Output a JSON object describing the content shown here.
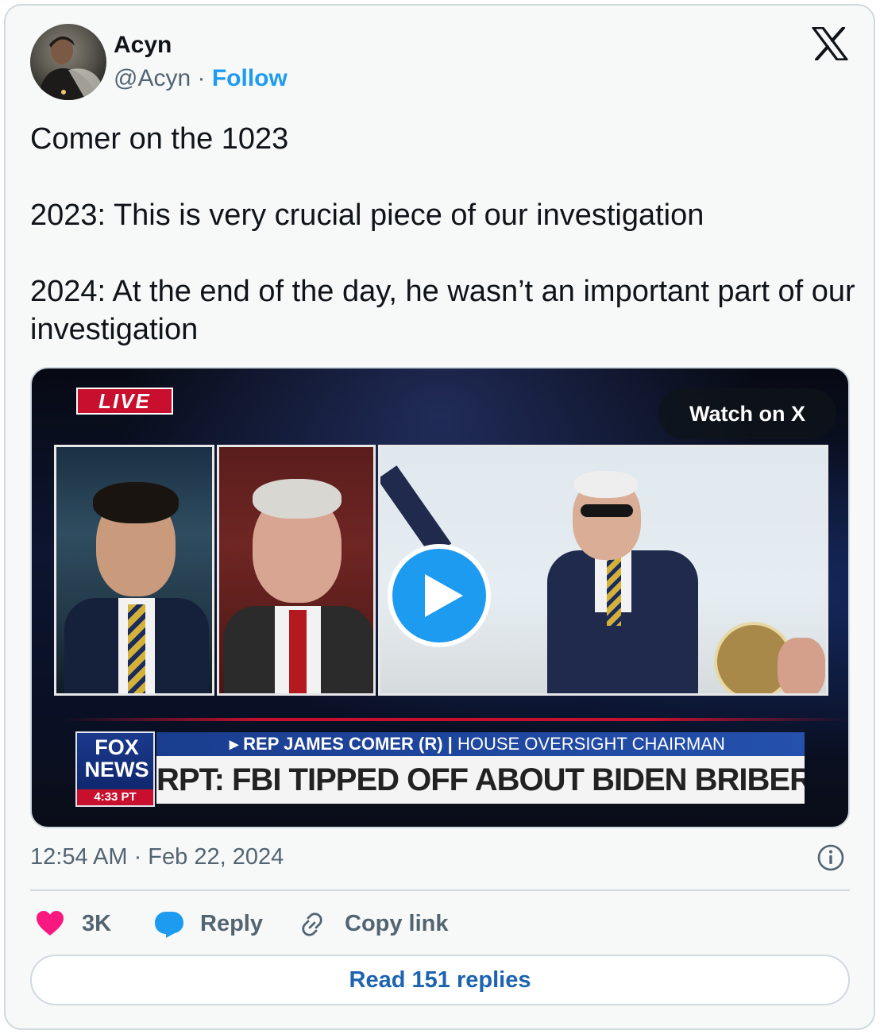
{
  "author": {
    "name": "Acyn",
    "handle": "@Acyn",
    "separator": "·",
    "follow_label": "Follow"
  },
  "platform_icon": "x-logo-icon",
  "tweet": {
    "line1": "Comer on the 1023",
    "line2": "2023: This is very crucial piece of our investigation",
    "line3": "2024: At the end of the day, he wasn’t an important part of our investigation"
  },
  "media": {
    "live_label": "LIVE",
    "watch_label": "Watch on X",
    "network": "FOX NEWS",
    "network_time": "4:33 PT",
    "chyron_name": "REP JAMES COMER (R)",
    "chyron_title": "HOUSE OVERSIGHT CHAIRMAN",
    "chyron_headline": "RPT: FBI TIPPED OFF ABOUT BIDEN BRIBERY"
  },
  "meta": {
    "timestamp": "12:54 AM · Feb 22, 2024"
  },
  "actions": {
    "likes": "3K",
    "reply_label": "Reply",
    "copy_label": "Copy link"
  },
  "read_replies_label": "Read 151 replies",
  "colors": {
    "accent": "#1d9bf0",
    "like": "#f91880",
    "text_secondary": "#536471",
    "border": "#cfd9de"
  }
}
